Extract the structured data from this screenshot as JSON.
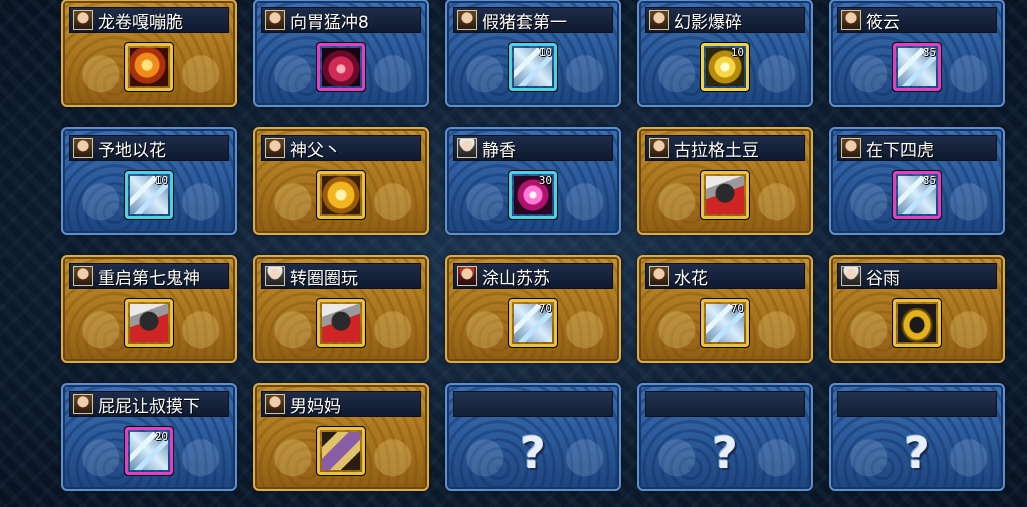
{
  "cards": [
    {
      "style": "gold",
      "name": "龙卷嘎嘣脆",
      "avatar": "brown",
      "item": {
        "icon": "fire-orb-icon",
        "frame": "gold",
        "count": ""
      }
    },
    {
      "style": "blue",
      "name": "向胃猛冲8",
      "avatar": "brown",
      "item": {
        "icon": "red-orb-icon",
        "frame": "pink",
        "count": ""
      }
    },
    {
      "style": "blue",
      "name": "假猪套第一",
      "avatar": "brown",
      "item": {
        "icon": "crystal-shard-icon",
        "frame": "cyan",
        "count": "10"
      }
    },
    {
      "style": "blue",
      "name": "幻影爆碎",
      "avatar": "brown",
      "item": {
        "icon": "light-orb-icon",
        "frame": "yellow",
        "count": "10"
      }
    },
    {
      "style": "blue",
      "name": "筱云",
      "avatar": "brown",
      "item": {
        "icon": "crystal-shard-icon",
        "frame": "pink",
        "count": "35"
      }
    },
    {
      "style": "blue",
      "name": "予地以花",
      "avatar": "brown",
      "item": {
        "icon": "crystal-shard-icon",
        "frame": "cyan",
        "count": "10"
      }
    },
    {
      "style": "gold",
      "name": "神父丶",
      "avatar": "brown",
      "item": {
        "icon": "gold-orb-icon",
        "frame": "gold",
        "count": ""
      }
    },
    {
      "style": "blue",
      "name": "静香",
      "avatar": "white",
      "item": {
        "icon": "pink-orb-icon",
        "frame": "cyan",
        "count": "30"
      }
    },
    {
      "style": "gold",
      "name": "古拉格土豆",
      "avatar": "brown",
      "item": {
        "icon": "gauntlet-icon",
        "frame": "gold",
        "count": ""
      }
    },
    {
      "style": "blue",
      "name": "在下四虎",
      "avatar": "brown",
      "item": {
        "icon": "crystal-shard-icon",
        "frame": "pink",
        "count": "35"
      }
    },
    {
      "style": "gold",
      "name": "重启第七鬼神",
      "avatar": "brown",
      "item": {
        "icon": "gauntlet-icon",
        "frame": "gold",
        "count": ""
      }
    },
    {
      "style": "gold",
      "name": "转圈圈玩",
      "avatar": "white",
      "item": {
        "icon": "gauntlet-icon",
        "frame": "gold",
        "count": ""
      }
    },
    {
      "style": "gold",
      "name": "涂山苏苏",
      "avatar": "red",
      "item": {
        "icon": "crystal-shard-icon",
        "frame": "gold",
        "count": "70"
      }
    },
    {
      "style": "gold",
      "name": "水花",
      "avatar": "brown",
      "item": {
        "icon": "crystal-shard-icon",
        "frame": "gold",
        "count": "70"
      }
    },
    {
      "style": "gold",
      "name": "谷雨",
      "avatar": "white",
      "item": {
        "icon": "gold-ring-icon",
        "frame": "gold",
        "count": ""
      }
    },
    {
      "style": "blue",
      "name": "屁屁让叔摸下",
      "avatar": "brown",
      "item": {
        "icon": "crystal-shard-icon",
        "frame": "pink",
        "count": "20"
      }
    },
    {
      "style": "gold",
      "name": "男妈妈",
      "avatar": "brown",
      "item": {
        "icon": "scroll-icon",
        "frame": "gold",
        "count": ""
      }
    },
    {
      "style": "blue",
      "name": "",
      "avatar": "",
      "item": null,
      "placeholder": "?"
    },
    {
      "style": "blue",
      "name": "",
      "avatar": "",
      "item": null,
      "placeholder": "?"
    },
    {
      "style": "blue",
      "name": "",
      "avatar": "",
      "item": null,
      "placeholder": "?"
    }
  ]
}
